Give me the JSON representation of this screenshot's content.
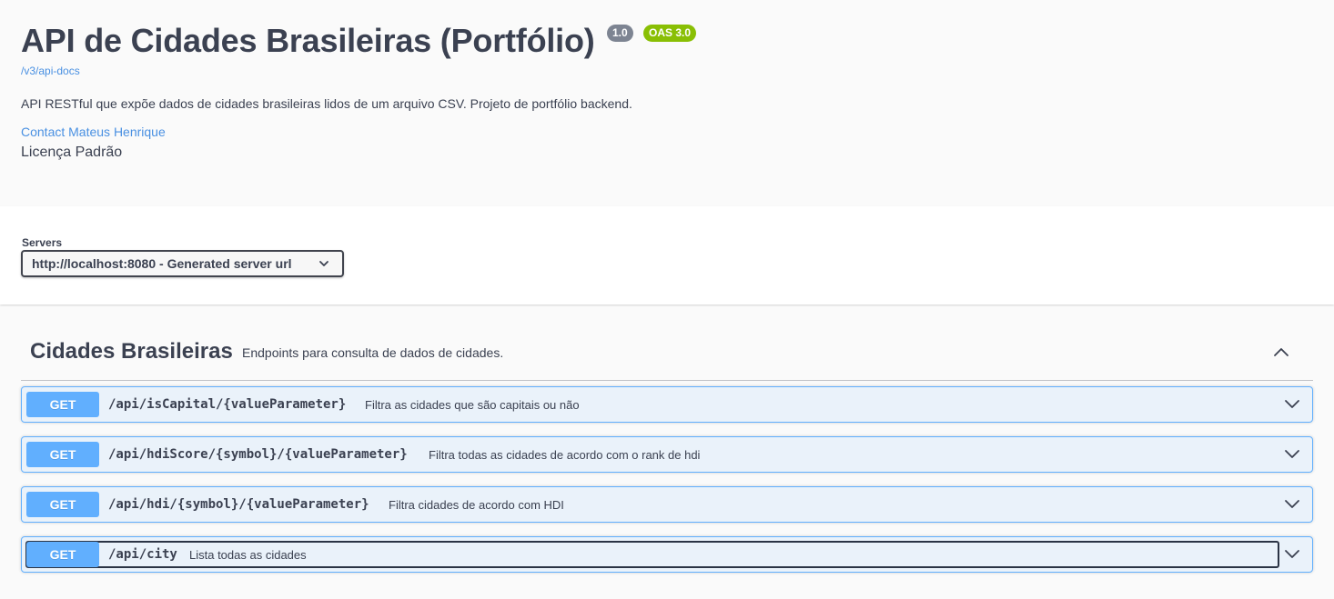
{
  "info": {
    "title": "API de Cidades Brasileiras (Portfólio)",
    "version_badge": "1.0",
    "oas_badge": "OAS 3.0",
    "docs_link": "/v3/api-docs",
    "description": "API RESTful que expõe dados de cidades brasileiras lidos de um arquivo CSV. Projeto de portfólio backend.",
    "contact_link": "Contact Mateus Henrique",
    "license": "Licença Padrão"
  },
  "servers": {
    "label": "Servers",
    "selected": "http://localhost:8080 - Generated server url"
  },
  "tag": {
    "name": "Cidades Brasileiras",
    "description": "Endpoints para consulta de dados de cidades.",
    "expanded": true,
    "operations": [
      {
        "method": "GET",
        "path": "/api/isCapital/{valueParameter}",
        "summary": "Filtra as cidades que são capitais ou não"
      },
      {
        "method": "GET",
        "path": "/api/hdiScore/{symbol}/{valueParameter}",
        "summary": "Filtra todas as cidades de acordo com o rank de hdi"
      },
      {
        "method": "GET",
        "path": "/api/hdi/{symbol}/{valueParameter}",
        "summary": "Filtra cidades de acordo com HDI"
      },
      {
        "method": "GET",
        "path": "/api/city",
        "summary": "Lista todas as cidades"
      }
    ]
  },
  "colors": {
    "get_method": "#61affe",
    "link": "#4990e2",
    "version_badge": "#7d8492",
    "oas_badge": "#89bf04",
    "text": "#3b4151"
  },
  "icons": {
    "server_dropdown": "chevron-down-icon",
    "tag_toggle": "chevron-up-icon",
    "operation_toggle": "chevron-down-icon"
  }
}
